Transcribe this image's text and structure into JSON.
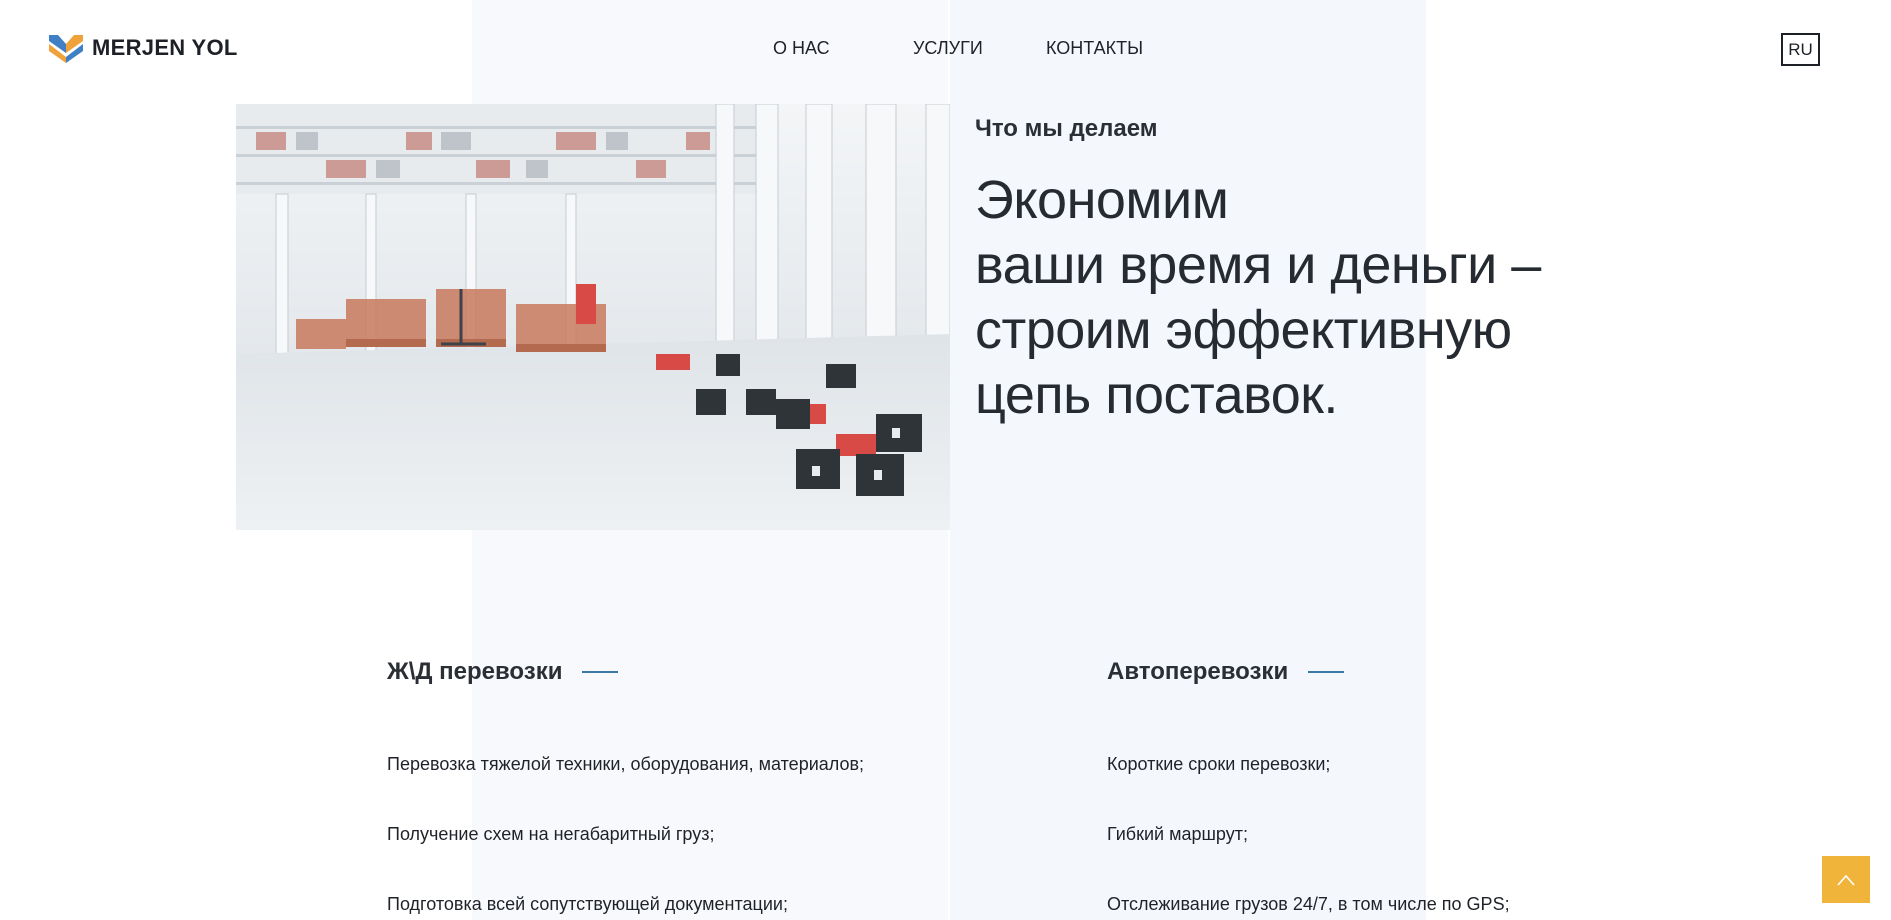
{
  "header": {
    "logo_text": "MERJEN YOL",
    "logo_icon": "m-chevron-logo-icon",
    "nav": {
      "about": "О НАС",
      "services": "УСЛУГИ",
      "contacts": "КОНТАКТЫ"
    },
    "lang": "RU"
  },
  "hero": {
    "image_alt": "warehouse-photo",
    "kicker": "Что мы делаем",
    "title_lines": [
      "Экономим",
      "ваши время и деньги –",
      "строим эффективную",
      "цепь поставок."
    ]
  },
  "services": [
    {
      "title": "Ж\\Д перевозки",
      "items": [
        "Перевозка тяжелой техники, оборудования, материалов;",
        "Получение схем на негабаритный груз;",
        "Подготовка всей сопутствующей документации;"
      ]
    },
    {
      "title": "Автоперевозки",
      "items": [
        "Короткие сроки перевозки;",
        "Гибкий маршрут;",
        "Отслеживание грузов 24/7, в том числе по GPS;"
      ]
    }
  ],
  "colors": {
    "accent_rule": "#3a78a8",
    "to_top_button": "#f0b43b",
    "logo_blue": "#3f7fc6",
    "logo_orange": "#f0a23a",
    "text_dark": "#1f2329"
  },
  "to_top_icon": "chevron-up-icon"
}
